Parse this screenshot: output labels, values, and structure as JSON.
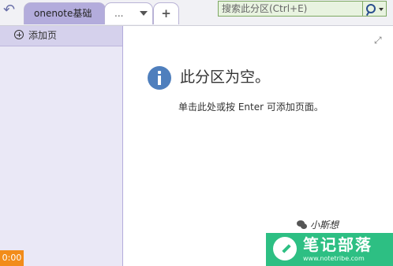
{
  "tabs": {
    "active_label": "onenote基础",
    "more_label": "...",
    "add_label": "+"
  },
  "search": {
    "placeholder": "搜索此分区(Ctrl+E)"
  },
  "sidebar": {
    "add_page_label": "添加页"
  },
  "main": {
    "empty_title": "此分区为空。",
    "empty_instruction": "单击此处或按 Enter 可添加页面。"
  },
  "timer": "0:00",
  "watermark": {
    "small_label": "小斯想",
    "site_name": "笔记部落",
    "site_url": "www.notetribe.com"
  },
  "icons": {
    "back": "back-arrow-icon",
    "search": "search-icon",
    "add_page": "plus-circle-icon",
    "info": "info-icon",
    "expand": "expand-icon"
  },
  "colors": {
    "active_tab": "#b3acdc",
    "sidebar": "#eae8f6",
    "search_bg": "#e8f3e0",
    "info": "#4f7fbd",
    "timer": "#f28c1a",
    "badge": "#2dbf83"
  }
}
